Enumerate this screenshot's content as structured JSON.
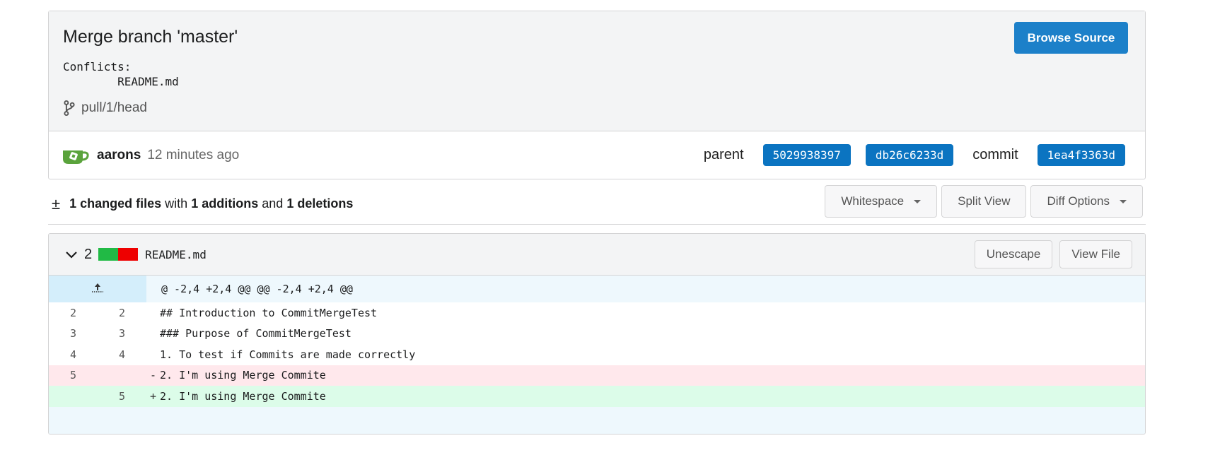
{
  "commit": {
    "title": "Merge branch 'master'",
    "message": "Conflicts:\n\tREADME.md",
    "branch": "pull/1/head",
    "browse_label": "Browse Source",
    "author": "aarons",
    "time": "12 minutes ago",
    "parent_label": "parent",
    "parents": [
      "5029938397",
      "db26c6233d"
    ],
    "commit_label": "commit",
    "sha": "1ea4f3363d"
  },
  "summary": {
    "icon": "±",
    "files_num": "1",
    "files_word": "changed files",
    "with": "with",
    "add_num": "1",
    "add_word": "additions",
    "and": "and",
    "del_num": "1",
    "del_word": "deletions",
    "whitespace_label": "Whitespace",
    "split_label": "Split View",
    "diff_options_label": "Diff Options"
  },
  "file": {
    "count": "2",
    "name": "README.md",
    "unescape_label": "Unescape",
    "view_label": "View File",
    "hunk_header": "@ -2,4 +2,4 @@ @@ -2,4 +2,4 @@",
    "lines": [
      {
        "old": "2",
        "new": "2",
        "sign": "",
        "code": "## Introduction to CommitMergeTest"
      },
      {
        "old": "3",
        "new": "3",
        "sign": "",
        "code": "### Purpose of CommitMergeTest"
      },
      {
        "old": "4",
        "new": "4",
        "sign": "",
        "code": "1. To test if Commits are made correctly"
      },
      {
        "old": "5",
        "new": "",
        "sign": "-",
        "code": "2. I'm using Merge Commite"
      },
      {
        "old": "",
        "new": "5",
        "sign": "+",
        "code": "2. I'm using Merge Commite"
      }
    ]
  },
  "colors": {
    "primary": "#1c80c9",
    "sha_bg": "#0b74c1",
    "add_bar": "#21ba45",
    "del_bar": "#ee0000",
    "del_row": "#ffe8ec",
    "add_row": "#dcfce9",
    "hunk_row": "#eef8fd"
  },
  "icons": {
    "branch": "git-branch-icon",
    "avatar": "gitea-avatar",
    "expand": "expand-up-icon",
    "chevron": "chevron-down-icon",
    "caret": "caret-down-icon"
  }
}
